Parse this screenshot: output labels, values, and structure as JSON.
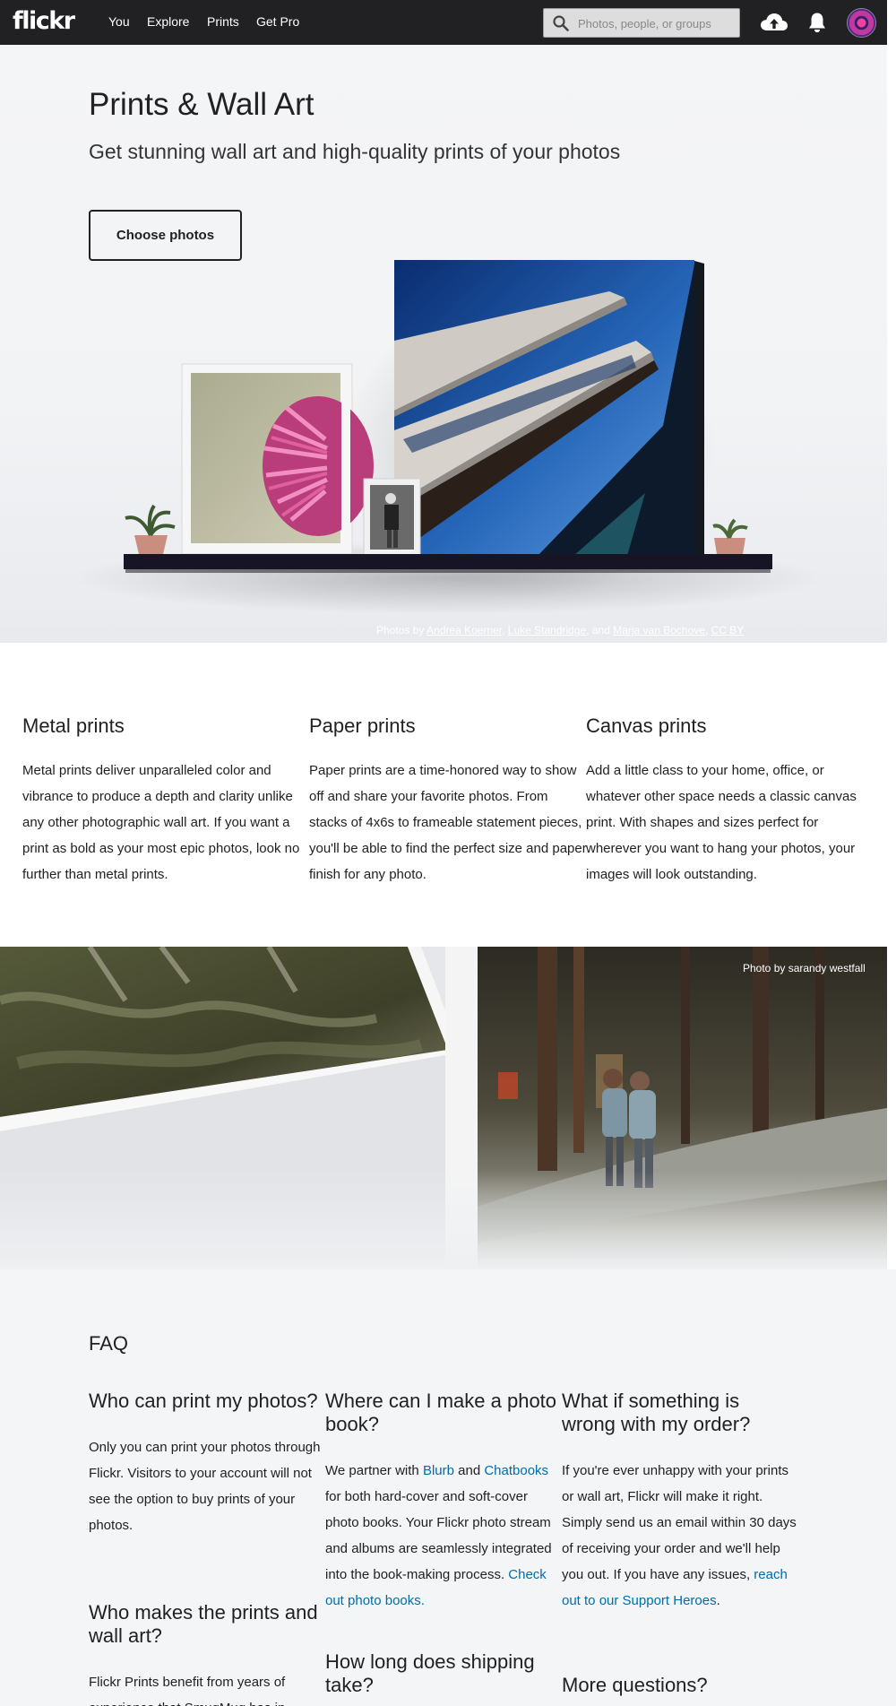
{
  "nav": {
    "logo": "flickr",
    "links": [
      "You",
      "Explore",
      "Prints",
      "Get Pro"
    ],
    "search_placeholder": "Photos, people, or groups"
  },
  "hero": {
    "title": "Prints & Wall Art",
    "subtitle": "Get stunning wall art and high-quality prints of your photos",
    "cta": "Choose photos",
    "credits": {
      "prefix": "Photos by ",
      "author1": "Andrea Koerner",
      "sep1": ", ",
      "author2": "Luke Standridge",
      "sep2": ", and ",
      "author3": "Marja van Bochove",
      "sep3": ", ",
      "license": "CC BY"
    }
  },
  "print_types": [
    {
      "title": "Metal prints",
      "body": "Metal prints deliver unparalleled color and vibrance to produce a depth and clarity unlike any other photographic wall art. If you want a print as bold as your most epic photos, look no further than metal prints."
    },
    {
      "title": "Paper prints",
      "body": "Paper prints are a time-honored way to show off and share your favorite photos. From stacks of 4x6s to frameable statement pieces, you'll be able to find the perfect size and paper finish for any photo."
    },
    {
      "title": "Canvas prints",
      "body": "Add a little class to your home, office, or whatever other space needs a classic canvas print. With shapes and sizes perfect for wherever you want to hang your photos, your images will look outstanding."
    }
  ],
  "band": {
    "credit": "Photo by sarandy westfall"
  },
  "faq": {
    "title": "FAQ",
    "q1": {
      "title": "Who can print my photos?",
      "body": "Only you can print your photos through Flickr. Visitors to your account will not see the option to buy prints of your photos."
    },
    "q2": {
      "title": "Where can I make a photo book?",
      "t1": "We partner with ",
      "l1": "Blurb",
      "t2": " and ",
      "l2": "Chatbooks",
      "t3": " for both hard-cover and soft-cover photo books. Your Flickr photo stream and albums are seamlessly integrated into the book-making process. ",
      "l3": "Check out photo books."
    },
    "q3": {
      "title": "What if something is wrong with my order?",
      "t1": "If you're ever unhappy with your prints or wall art, Flickr will make it right. Simply send us an email within 30 days of receiving your order and we'll help you out. If you have any issues, ",
      "l1": "reach out to our Support Heroes",
      "t2": "."
    },
    "q4": {
      "title": "Who makes the prints and wall art?",
      "body": "Flickr Prints benefit from years of experience that SmugMug has in"
    },
    "q5": {
      "title": "How long does shipping take?"
    },
    "q6": {
      "title": "More questions?"
    }
  }
}
